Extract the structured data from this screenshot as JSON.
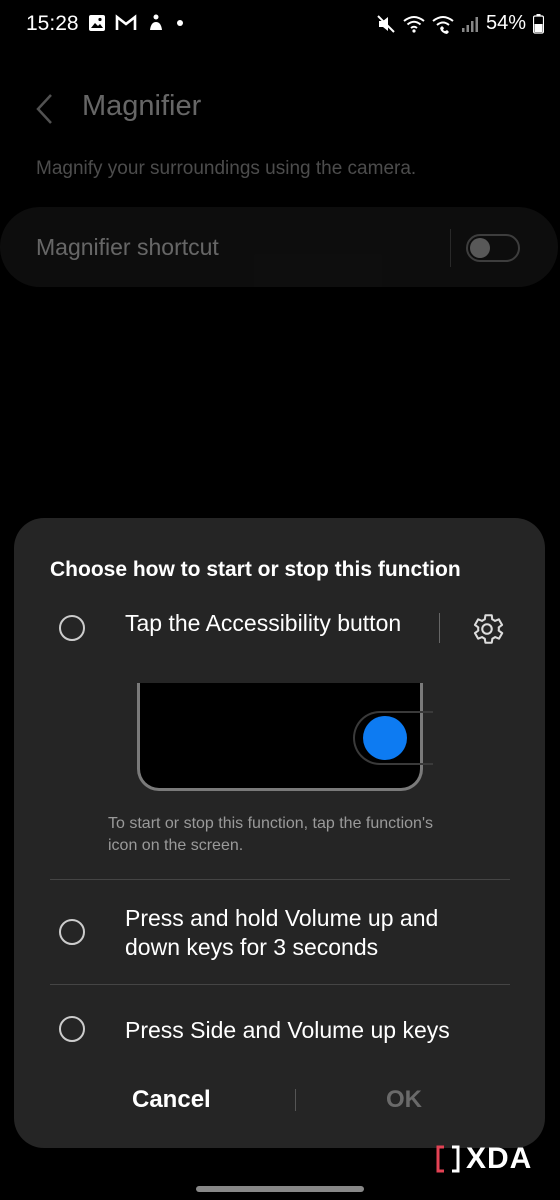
{
  "status_bar": {
    "time": "15:28",
    "battery": "54%",
    "notification_icons": [
      "image-icon",
      "gmail-icon",
      "gesture-icon",
      "dot-icon"
    ],
    "system_icons": [
      "mute-icon",
      "wifi-icon",
      "wifi-call-icon",
      "signal-icon",
      "battery-icon"
    ]
  },
  "page": {
    "title": "Magnifier",
    "description": "Magnify your surroundings using the camera.",
    "shortcut_label": "Magnifier shortcut",
    "shortcut_enabled": false
  },
  "dialog": {
    "title": "Choose how to start or stop this function",
    "options": [
      {
        "label": "Tap the Accessibility button",
        "selected": false
      },
      {
        "label_line1": "Press and hold Volume up and",
        "label_line2": "down keys for 3 seconds",
        "selected": false
      },
      {
        "label": "Press Side and Volume up keys",
        "selected": false
      }
    ],
    "hint_line1": "To start or stop this function, tap the function's",
    "hint_line2": "icon on the screen.",
    "cancel_label": "Cancel",
    "ok_label": "OK"
  },
  "watermark": {
    "text": "XDA"
  },
  "colors": {
    "accent": "#0d7bf2",
    "dialog_bg": "#252525",
    "background": "#000000"
  }
}
